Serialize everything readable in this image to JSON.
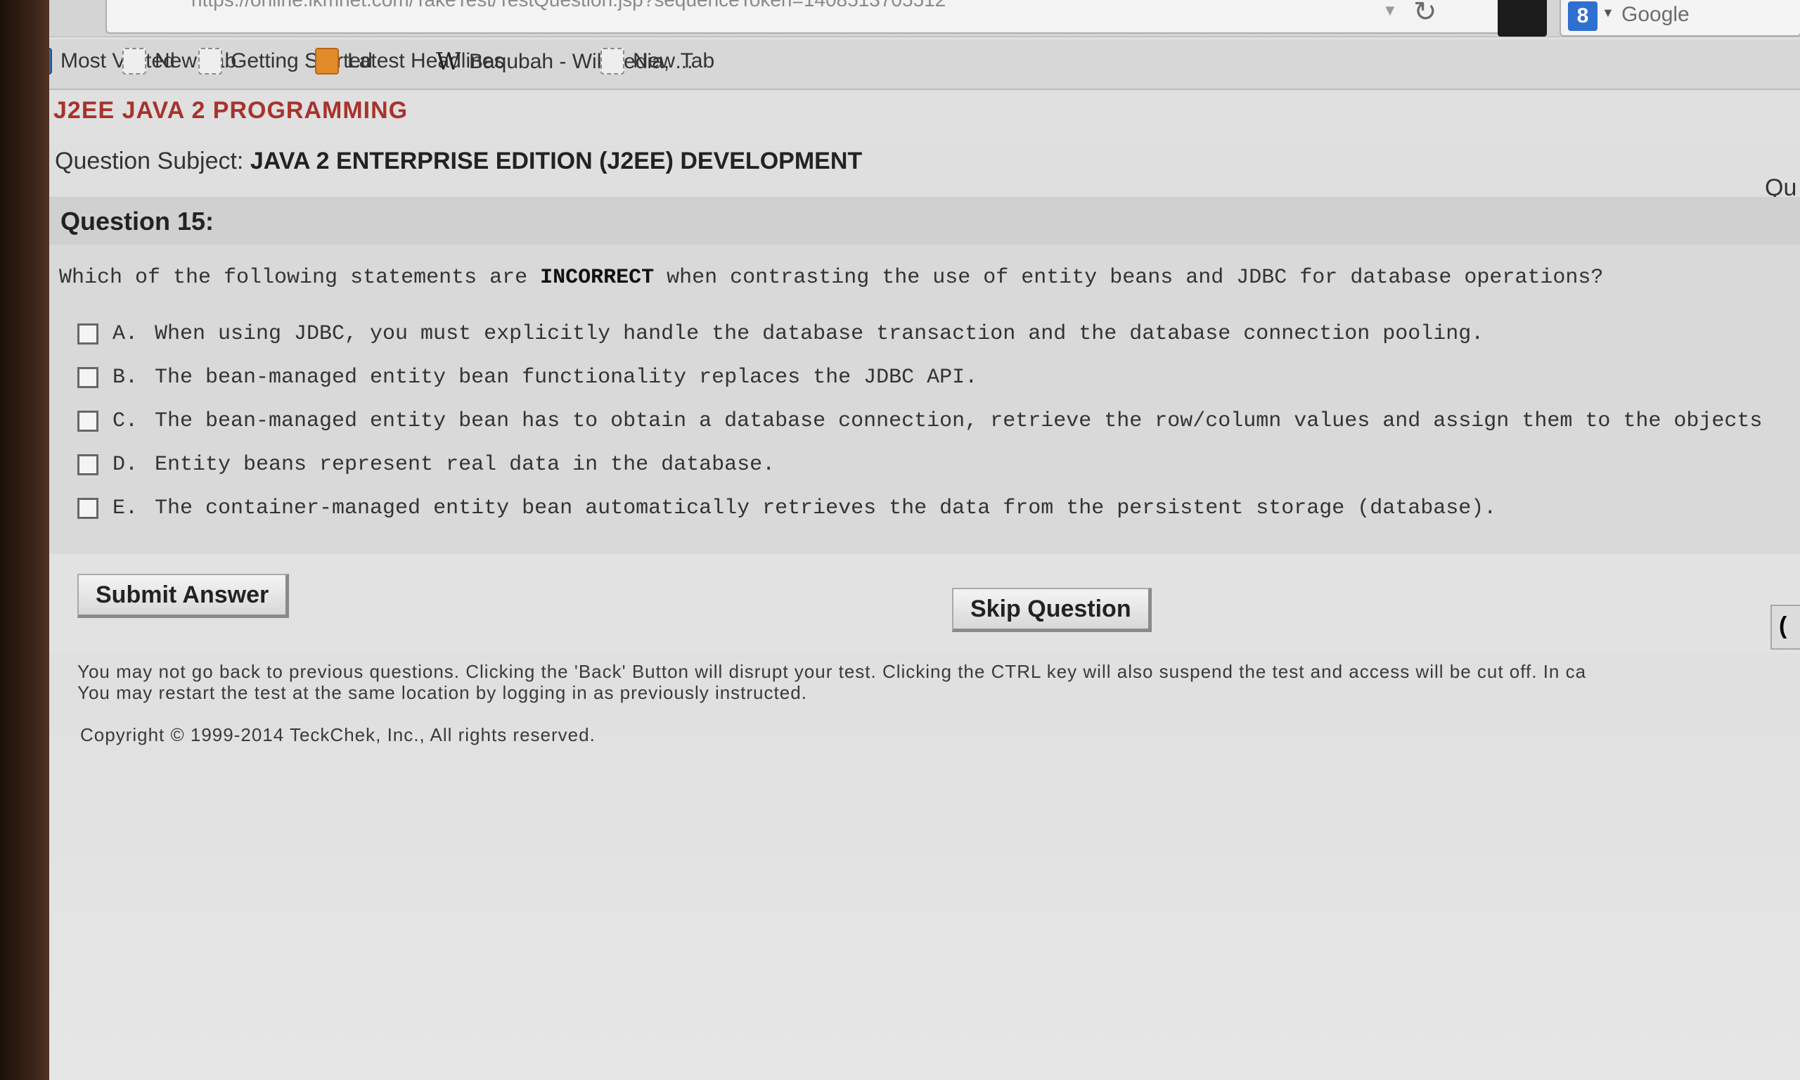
{
  "browser": {
    "url": "https://online.ikmnet.com/TakeTest/TestQuestion.jsp?sequenceToken=1408513705512",
    "search_engine": "Google",
    "search_icon_letter": "8"
  },
  "bookmarks": [
    {
      "label": "Most Visited",
      "icon": "most-visited-icon"
    },
    {
      "label": "New Tab",
      "icon": "page-icon"
    },
    {
      "label": "Getting Started",
      "icon": "page-icon"
    },
    {
      "label": "Latest Headlines",
      "icon": "rss-icon"
    },
    {
      "label": "Baqubah - Wikipedia, ...",
      "icon": "wikipedia-icon",
      "glyph": "W"
    },
    {
      "label": "New Tab",
      "icon": "page-icon"
    }
  ],
  "page": {
    "app_title": "J2EE JAVA 2 PROGRAMMING",
    "subject_label": "Question Subject:",
    "subject_value": "JAVA 2 ENTERPRISE EDITION (J2EE) DEVELOPMENT",
    "clipped_right_text": "Qu",
    "question_number": "Question 15:"
  },
  "question": {
    "prefix": "Which of the following statements are ",
    "emphasis": "INCORRECT",
    "suffix": " when contrasting the use of entity beans and JDBC for database operations?",
    "options": [
      {
        "letter": "A.",
        "text": "When using JDBC, you must explicitly handle the database transaction and the database connection pooling.",
        "checked": false
      },
      {
        "letter": "B.",
        "text": "The bean-managed entity bean functionality replaces the JDBC API.",
        "checked": false
      },
      {
        "letter": "C.",
        "text": "The bean-managed entity bean has to obtain a database connection, retrieve the row/column values and assign them to the objects",
        "checked": false
      },
      {
        "letter": "D.",
        "text": "Entity beans represent real data in the database.",
        "checked": false
      },
      {
        "letter": "E.",
        "text": "The container-managed entity bean automatically retrieves the data from the persistent storage (database).",
        "checked": false
      }
    ]
  },
  "actions": {
    "submit_label": "Submit Answer",
    "skip_label": "Skip Question",
    "clipped_button_label": "("
  },
  "footer": {
    "notice_line1": "You may not go back to previous questions. Clicking the 'Back' Button will disrupt your test. Clicking the CTRL key will also suspend the test and access will be cut off. In ca",
    "notice_line2": "You may restart the test at the same location by logging in as previously instructed.",
    "copyright": "Copyright © 1999-2014 TeckChek, Inc., All rights reserved."
  }
}
